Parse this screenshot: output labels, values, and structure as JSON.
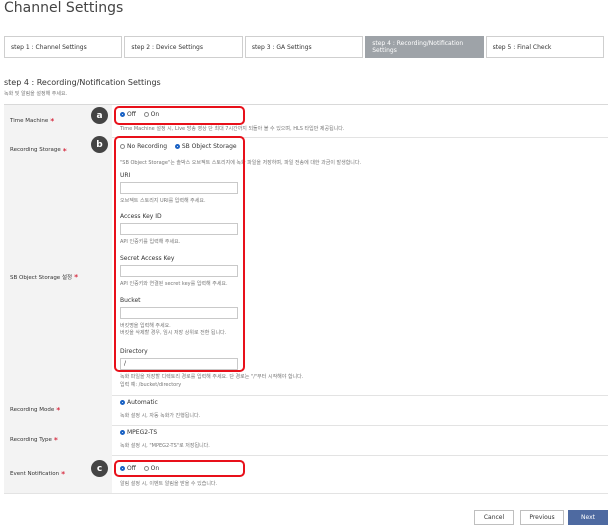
{
  "page_title": "Channel Settings",
  "steps": [
    "step 1 : Channel Settings",
    "step 2 : Device Settings",
    "step 3 : GA Settings",
    "step 4 : Recording/Notification Settings",
    "step 5 : Final Check"
  ],
  "section": {
    "title": "step 4 : Recording/Notification Settings",
    "subtitle": "녹화 및 알림을 설정해 주세요."
  },
  "time_machine": {
    "label": "Time Machine",
    "off": "Off",
    "on": "On",
    "hint": "Time Machine 설정 시, Live 방송 영상 단 최대 7시간까지 되돌아 볼 수 있으며, HLS 타입만 제공됩니다."
  },
  "recording_storage": {
    "label": "Recording Storage",
    "opt1": "No Recording",
    "opt2": "SB Object Storage",
    "hint": "\"SB Object Storage\"는 솔박스 오브젝트 스토리지에 녹화 파일을 저장하며, 파일 전송에 대한 과금이 발생합니다."
  },
  "sb_object_storage": {
    "label": "SB Object Storage 설정",
    "uri_label": "URI",
    "uri_hint": "오브젝트 스토리지 URI를 입력해 주세요.",
    "key_label": "Access Key ID",
    "key_hint": "API 인증키를 입력해 주세요.",
    "secret_label": "Secret Access Key",
    "secret_hint": "API 인증키와 연결된 secret key를 입력해 주세요.",
    "bucket_label": "Bucket",
    "bucket_hint1": "버킷명을 입력해 주세요.",
    "bucket_hint2": "버킷을 삭제할 경우, 임시 저장 상위로 전환 됩니다.",
    "dir_label": "Directory",
    "dir_value": "/",
    "dir_hint1": "녹화 파일을 저장할 디렉토리 경로를 입력해 주세요. 단 경로는 \"/\"부터 시작해야 합니다.",
    "dir_hint2": "입력 예: /bucket/directory"
  },
  "recording_mode": {
    "label": "Recording Mode",
    "opt": "Automatic",
    "hint": "녹화 설정 시, 자동 녹화가 진행됩니다."
  },
  "recording_type": {
    "label": "Recording Type",
    "opt": "MPEG2-TS",
    "hint": "녹화 설정 시, \"MPEG2-TS\"로 저장됩니다."
  },
  "event_notification": {
    "label": "Event Notification",
    "off": "Off",
    "on": "On",
    "hint": "알림 설정 시, 이벤트 알림을 받을 수 있습니다."
  },
  "badges": {
    "a": "a",
    "b": "b",
    "c": "c"
  },
  "buttons": {
    "cancel": "Cancel",
    "previous": "Previous",
    "next": "Next"
  },
  "colors": {
    "highlight": "#e8101a",
    "active_step": "#9ea3a8",
    "primary": "#4e6aa1",
    "required": "#d0021b"
  }
}
